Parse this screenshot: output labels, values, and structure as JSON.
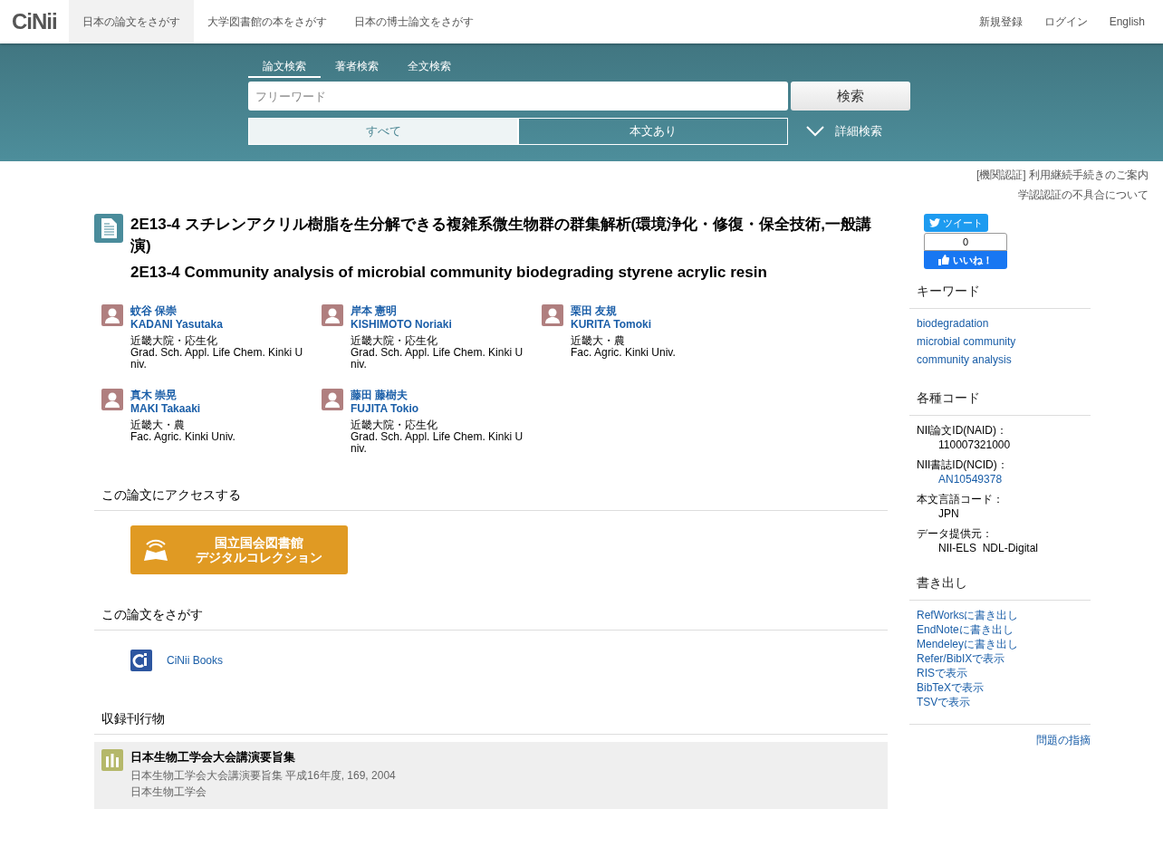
{
  "header": {
    "logo": "CiNii",
    "nav": [
      {
        "label": "日本の論文をさがす",
        "selected": true
      },
      {
        "label": "大学図書館の本をさがす",
        "selected": false
      },
      {
        "label": "日本の博士論文をさがす",
        "selected": false
      }
    ],
    "account_links": [
      "新規登録",
      "ログイン",
      "English"
    ]
  },
  "search": {
    "tabs": [
      {
        "label": "論文検索",
        "selected": true
      },
      {
        "label": "著者検索",
        "selected": false
      },
      {
        "label": "全文検索",
        "selected": false
      }
    ],
    "placeholder": "フリーワード",
    "button": "検索",
    "filters": [
      {
        "label": "すべて",
        "selected": true
      },
      {
        "label": "本文あり",
        "selected": false
      }
    ],
    "advanced": "詳細検索"
  },
  "notices": [
    "[機関認証] 利用継続手続きのご案内",
    "学認認証の不具合について"
  ],
  "article": {
    "title_ja": "2E13-4 スチレンアクリル樹脂を生分解できる複雑系微生物群の群集解析(環境浄化・修復・保全技術,一般講演)",
    "title_en": "2E13-4 Community analysis of microbial community biodegrading styrene acrylic resin",
    "authors": [
      {
        "name_ja": "蚊谷 保崇",
        "name_en": "KADANI Yasutaka",
        "affiliation_ja": "近畿大院・応生化",
        "affiliation_en": "Grad. Sch. Appl. Life Chem. Kinki Univ."
      },
      {
        "name_ja": "岸本 憲明",
        "name_en": "KISHIMOTO Noriaki",
        "affiliation_ja": "近畿大院・応生化",
        "affiliation_en": "Grad. Sch. Appl. Life Chem. Kinki Univ."
      },
      {
        "name_ja": "栗田 友規",
        "name_en": "KURITA Tomoki",
        "affiliation_ja": "近畿大・農",
        "affiliation_en": "Fac. Agric. Kinki Univ."
      },
      {
        "name_ja": "真木 崇晃",
        "name_en": "MAKI Takaaki",
        "affiliation_ja": "近畿大・農",
        "affiliation_en": "Fac. Agric. Kinki Univ."
      },
      {
        "name_ja": "藤田 藤樹夫",
        "name_en": "FUJITA Tokio",
        "affiliation_ja": "近畿大院・応生化",
        "affiliation_en": "Grad. Sch. Appl. Life Chem. Kinki Univ."
      }
    ]
  },
  "access": {
    "heading": "この論文にアクセスする",
    "button_lines": [
      "国立国会図書館",
      "デジタルコレクション"
    ]
  },
  "find": {
    "heading": "この論文をさがす",
    "link": "CiNii Books"
  },
  "journal": {
    "heading": "収録刊行物",
    "title": "日本生物工学会大会講演要旨集",
    "detail": "日本生物工学会大会講演要旨集 平成16年度, 169, 2004",
    "publisher": "日本生物工学会"
  },
  "sidebar": {
    "tweet": "ツイート",
    "like_count": "0",
    "like": "いいね！",
    "keywords": {
      "heading": "キーワード",
      "items": [
        "biodegradation",
        "microbial community",
        "community analysis"
      ]
    },
    "codes": {
      "heading": "各種コード",
      "items": [
        {
          "label": "NII論文ID(NAID)：",
          "value": "110007321000",
          "kind": "text"
        },
        {
          "label": "NII書誌ID(NCID)：",
          "value": "AN10549378",
          "kind": "link"
        },
        {
          "label": "本文言語コード：",
          "value": "JPN",
          "kind": "text"
        },
        {
          "label": "データ提供元：",
          "value": "NII-ELS  NDL-Digital",
          "kind": "text"
        }
      ]
    },
    "export": {
      "heading": "書き出し",
      "items": [
        "RefWorksに書き出し",
        "EndNoteに書き出し",
        "Mendeleyに書き出し",
        "Refer/BibIXで表示",
        "RISで表示",
        "BibTeXで表示",
        "TSVで表示"
      ]
    },
    "report": "問題の指摘"
  }
}
